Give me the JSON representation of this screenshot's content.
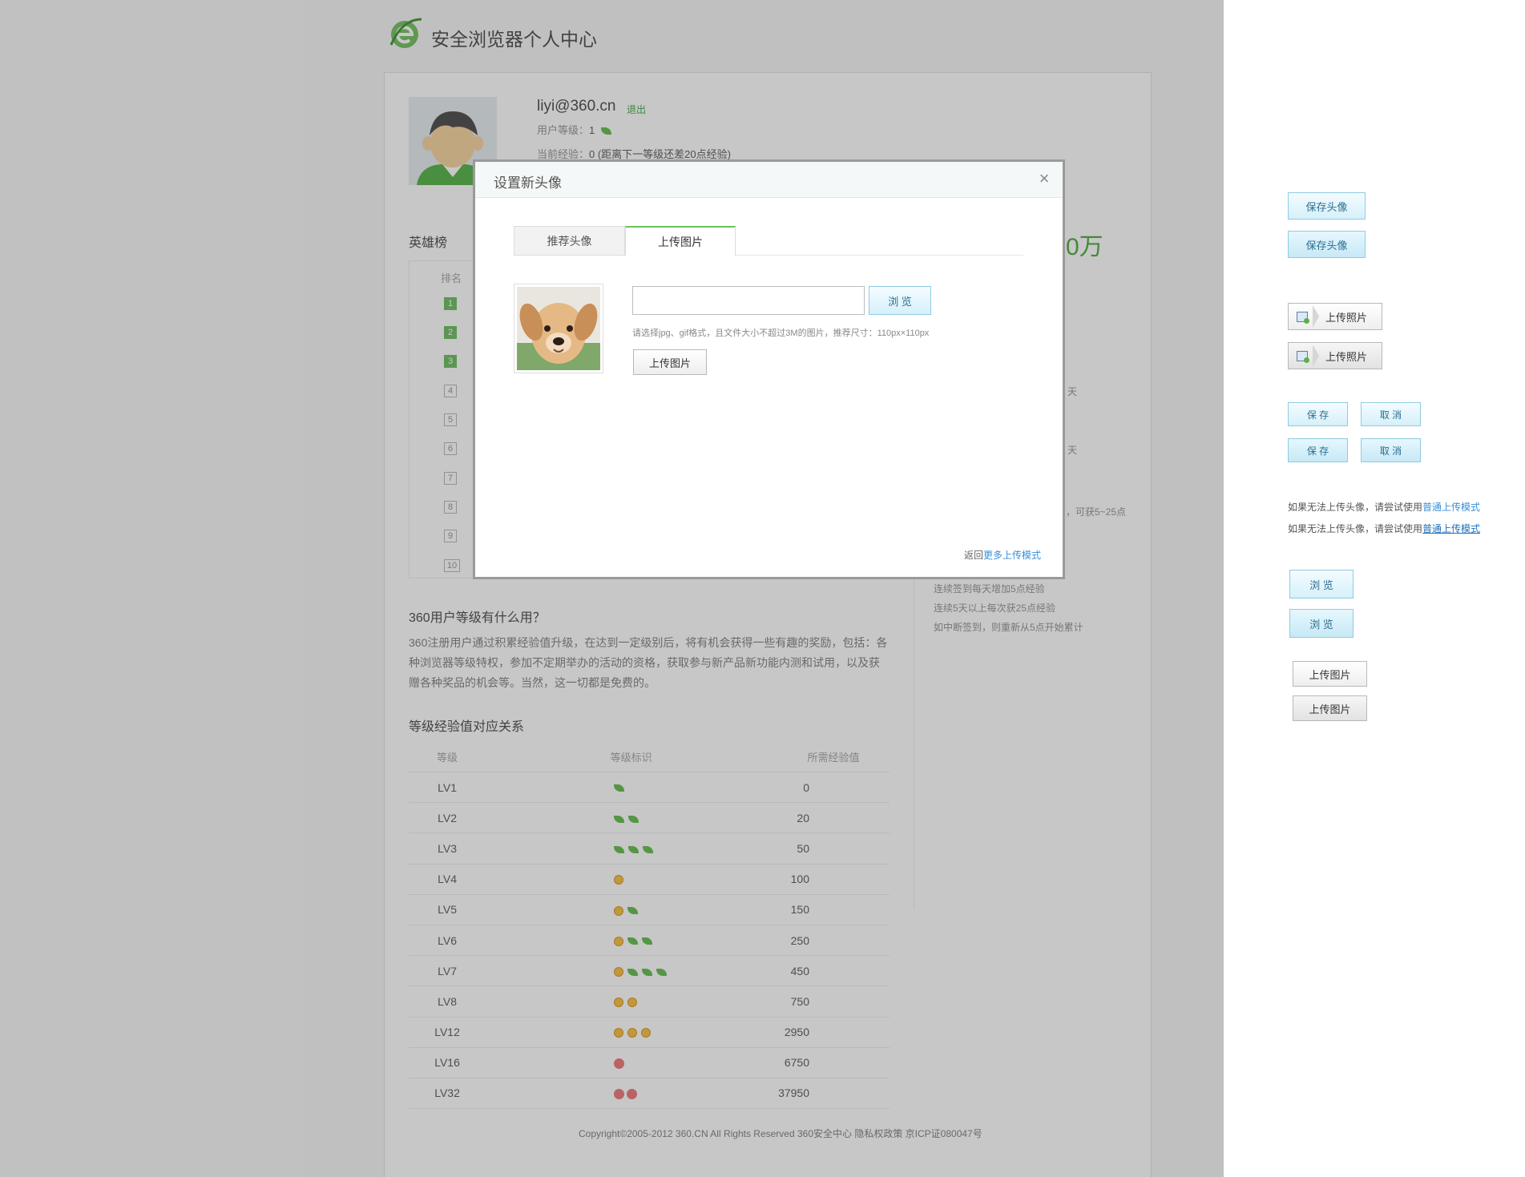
{
  "header": {
    "site_title": "安全浏览器个人中心"
  },
  "user": {
    "username": "liyi@360.cn",
    "logout": "退出",
    "level_label": "用户等级：",
    "level_value": "1",
    "exp_label": "当前经验：",
    "exp_value": "0 (距离下一等级还差20点经验)"
  },
  "heroes": {
    "title": "英雄榜",
    "col_rank": "排名",
    "ranks": [
      "1",
      "2",
      "3",
      "4",
      "5",
      "6",
      "7",
      "8",
      "9",
      "10"
    ]
  },
  "right_side": {
    "big_number_tail": "0万",
    "frag1": "天",
    "frag2": "天",
    "frag3": "，可获5~25点",
    "rule1": "连续签到每天增加5点经验",
    "rule2": "连续5天以上每次获25点经验",
    "rule3": "如中断签到，则重新从5点开始累计"
  },
  "level_info": {
    "title": "360用户等级有什么用？",
    "desc": "360注册用户通过积累经验值升级，在达到一定级别后，将有机会获得一些有趣的奖励，包括：各种浏览器等级特权，参加不定期举办的活动的资格，获取参与新产品新功能内测和试用，以及获赠各种奖品的机会等。当然，这一切都是免费的。"
  },
  "level_table": {
    "title": "等级经验值对应关系",
    "headers": [
      "等级",
      "等级标识",
      "所需经验值"
    ],
    "rows": [
      {
        "level": "LV1",
        "icons": [
          "leaf"
        ],
        "exp": "0"
      },
      {
        "level": "LV2",
        "icons": [
          "leaf",
          "leaf"
        ],
        "exp": "20"
      },
      {
        "level": "LV3",
        "icons": [
          "leaf",
          "leaf",
          "leaf"
        ],
        "exp": "50"
      },
      {
        "level": "LV4",
        "icons": [
          "sun"
        ],
        "exp": "100"
      },
      {
        "level": "LV5",
        "icons": [
          "sun",
          "leaf"
        ],
        "exp": "150"
      },
      {
        "level": "LV6",
        "icons": [
          "sun",
          "leaf",
          "leaf"
        ],
        "exp": "250"
      },
      {
        "level": "LV7",
        "icons": [
          "sun",
          "leaf",
          "leaf",
          "leaf"
        ],
        "exp": "450"
      },
      {
        "level": "LV8",
        "icons": [
          "sun",
          "sun"
        ],
        "exp": "750"
      },
      {
        "level": "LV12",
        "icons": [
          "sun",
          "sun",
          "sun"
        ],
        "exp": "2950"
      },
      {
        "level": "LV16",
        "icons": [
          "apple"
        ],
        "exp": "6750"
      },
      {
        "level": "LV32",
        "icons": [
          "apple",
          "apple"
        ],
        "exp": "37950"
      }
    ]
  },
  "footer": {
    "copyright": "Copyright©2005-2012 360.CN All Rights Reserved 360安全中心 隐私权政策 京ICP证080047号"
  },
  "dialog": {
    "title": "设置新头像",
    "tabs": [
      "推荐头像",
      "上传图片"
    ],
    "active_tab": "上传图片",
    "file_value": "",
    "browse_label": "浏 览",
    "hint": "请选择jpg、gif格式，且文件大小不超过3M的图片，推荐尺寸：110px×110px",
    "upload_label": "上传图片",
    "back_prefix": "返回",
    "back_link": "更多上传模式"
  },
  "sprites": {
    "save_avatar": "保存头像",
    "upload_photo": "上传照片",
    "save": "保 存",
    "cancel": "取 消",
    "tip_prefix": "如果无法上传头像，请尝试使用",
    "tip_link": "普通上传模式",
    "browse": "浏 览",
    "upload_image": "上传图片"
  },
  "colors": {
    "accent_green": "#6dc15a",
    "link_blue": "#3a8fd8",
    "button_blue": "#d6f0fa"
  }
}
